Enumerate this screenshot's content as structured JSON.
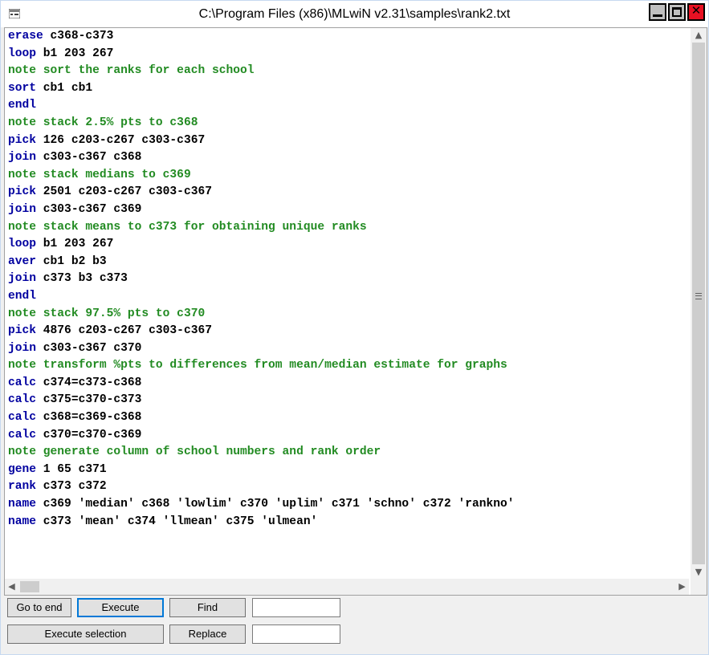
{
  "window": {
    "title": "C:\\Program Files (x86)\\MLwiN v2.31\\samples\\rank2.txt"
  },
  "icons": {
    "app": "macro-window-icon",
    "minimize": "minimize-icon",
    "maximize": "maximize-icon",
    "close": "close-icon"
  },
  "colors": {
    "keyword": "#0000a0",
    "note": "#228b22",
    "text": "#000000",
    "close_button": "#e81123"
  },
  "editor": {
    "lines": [
      {
        "kw": "erase",
        "rest": " c368-c373"
      },
      {
        "kw": "loop",
        "rest": " b1 203 267"
      },
      {
        "kw": "note",
        "rest": " sort the ranks for each school"
      },
      {
        "kw": "sort",
        "rest": " cb1 cb1"
      },
      {
        "kw": "endl",
        "rest": ""
      },
      {
        "kw": "note",
        "rest": " stack 2.5% pts to c368"
      },
      {
        "kw": "pick",
        "rest": " 126 c203-c267 c303-c367"
      },
      {
        "kw": "join",
        "rest": " c303-c367 c368"
      },
      {
        "kw": "note",
        "rest": " stack medians to c369"
      },
      {
        "kw": "pick",
        "rest": " 2501 c203-c267 c303-c367"
      },
      {
        "kw": "join",
        "rest": " c303-c367 c369"
      },
      {
        "kw": "note",
        "rest": " stack means to c373 for obtaining unique ranks"
      },
      {
        "kw": "loop",
        "rest": " b1 203 267"
      },
      {
        "kw": "aver",
        "rest": " cb1 b2 b3"
      },
      {
        "kw": "join",
        "rest": " c373 b3 c373"
      },
      {
        "kw": "endl",
        "rest": ""
      },
      {
        "kw": "note",
        "rest": " stack 97.5% pts to c370"
      },
      {
        "kw": "pick",
        "rest": " 4876 c203-c267 c303-c367"
      },
      {
        "kw": "join",
        "rest": " c303-c367 c370"
      },
      {
        "kw": "note",
        "rest": " transform %pts to differences from mean/median estimate for graphs"
      },
      {
        "kw": "calc",
        "rest": " c374=c373-c368"
      },
      {
        "kw": "calc",
        "rest": " c375=c370-c373"
      },
      {
        "kw": "calc",
        "rest": " c368=c369-c368"
      },
      {
        "kw": "calc",
        "rest": " c370=c370-c369"
      },
      {
        "kw": "note",
        "rest": " generate column of school numbers and rank order"
      },
      {
        "kw": "gene",
        "rest": " 1 65 c371"
      },
      {
        "kw": "rank",
        "rest": " c373 c372"
      },
      {
        "kw": "name",
        "rest": " c369 'median' c368 'lowlim' c370 'uplim' c371 'schno' c372 'rankno'"
      },
      {
        "kw": "name",
        "rest": " c373 'mean' c374 'llmean' c375 'ulmean'"
      }
    ]
  },
  "toolbar": {
    "go_to_end": "Go to end",
    "execute": "Execute",
    "find": "Find",
    "find_value": "",
    "execute_selection": "Execute selection",
    "replace": "Replace",
    "replace_value": ""
  }
}
